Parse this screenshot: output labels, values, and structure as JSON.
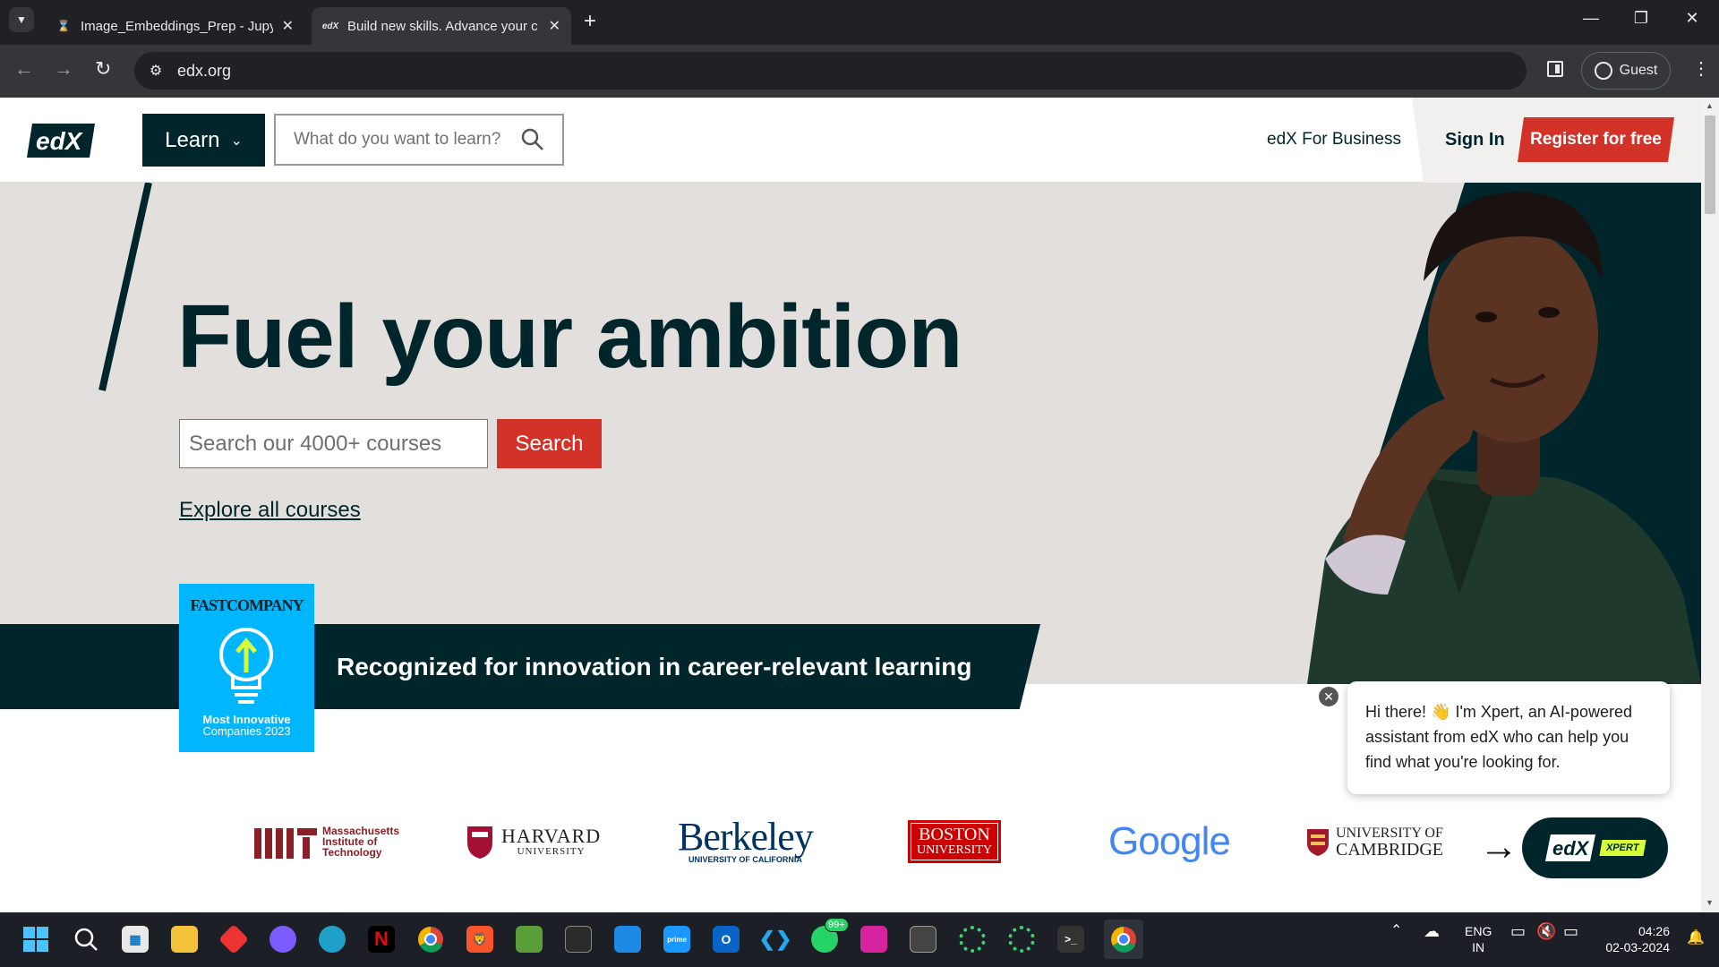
{
  "browser": {
    "tabs": [
      {
        "title": "Image_Embeddings_Prep - Jupy",
        "active": false
      },
      {
        "title": "Build new skills. Advance your c",
        "active": true
      }
    ],
    "address": "edx.org",
    "profile_label": "Guest"
  },
  "site_header": {
    "logo_text": "edX",
    "learn_label": "Learn",
    "search_placeholder": "What do you want to learn?",
    "business_link": "edX For Business",
    "signin_label": "Sign In",
    "register_label": "Register for free"
  },
  "hero": {
    "headline": "Fuel your ambition",
    "search_placeholder": "Search our 4000+ courses",
    "search_button": "Search",
    "explore_link": "Explore all courses",
    "award_brand": "FASTCOMPANY",
    "award_caption_line1": "Most Innovative",
    "award_caption_line2": "Companies 2023",
    "banner_text": "Recognized for innovation in career-relevant learning"
  },
  "partners": [
    {
      "name": "Massachusetts Institute of Technology"
    },
    {
      "name": "HARVARD",
      "sub": "UNIVERSITY"
    },
    {
      "name": "Berkeley",
      "sub": "UNIVERSITY OF CALIFORNIA"
    },
    {
      "name": "BOSTON",
      "sub": "UNIVERSITY"
    },
    {
      "name": "Google"
    },
    {
      "name": "UNIVERSITY OF",
      "sub": "CAMBRIDGE"
    }
  ],
  "mit_lines": [
    "Massachusetts",
    "Institute of",
    "Technology"
  ],
  "chat": {
    "message": "Hi there! 👋 I'm Xpert, an AI-powered assistant from edX who can help you find what you're looking for.",
    "button_logo": "edX",
    "button_tag": "XPERT"
  },
  "taskbar": {
    "lang_line1": "ENG",
    "lang_line2": "IN",
    "time": "04:26",
    "date": "02-03-2024",
    "whatsapp_badge": "99+"
  },
  "colors": {
    "brand_dark": "#00262b",
    "brand_red": "#d23228",
    "hero_bg": "#e3dfdd",
    "fastco_blue": "#00b6ff"
  }
}
